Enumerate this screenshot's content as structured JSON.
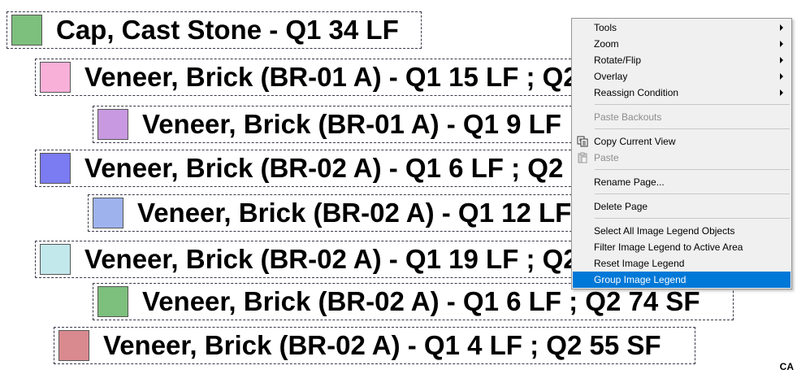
{
  "legend": {
    "items": [
      {
        "text": "Cap, Cast Stone - Q1 34 LF",
        "color": "#7dbf7d"
      },
      {
        "text": "Veneer, Brick (BR-01 A) - Q1 15 LF ; Q2",
        "color": "#f9b0d8"
      },
      {
        "text": "Veneer, Brick (BR-01 A) - Q1 9 LF ; Q2",
        "color": "#c899e0"
      },
      {
        "text": "Veneer, Brick (BR-02 A) - Q1 6 LF ; Q2",
        "color": "#7b7bf2"
      },
      {
        "text": "Veneer, Brick (BR-02 A) - Q1 12 LF ; Q2",
        "color": "#9eb3ee"
      },
      {
        "text": "Veneer, Brick (BR-02 A) - Q1 19 LF ; Q2",
        "color": "#c3e8ec"
      },
      {
        "text": "Veneer, Brick (BR-02 A) - Q1 6 LF ; Q2 74 SF",
        "color": "#7dbf7d"
      },
      {
        "text": "Veneer, Brick (BR-02 A) - Q1 4 LF ; Q2 55 SF",
        "color": "#d98a8f"
      }
    ]
  },
  "corner_label": "CA",
  "context_menu": {
    "tools": "Tools",
    "zoom": "Zoom",
    "rotate_flip": "Rotate/Flip",
    "overlay": "Overlay",
    "reassign_condition": "Reassign Condition",
    "paste_backouts": "Paste Backouts",
    "copy_current_view": "Copy Current View",
    "paste": "Paste",
    "rename_page": "Rename Page...",
    "delete_page": "Delete Page",
    "select_all_legend": "Select All Image Legend Objects",
    "filter_legend": "Filter Image Legend to Active Area",
    "reset_legend": "Reset Image Legend",
    "group_legend": "Group Image Legend",
    "highlight_color": "#0078d7"
  }
}
